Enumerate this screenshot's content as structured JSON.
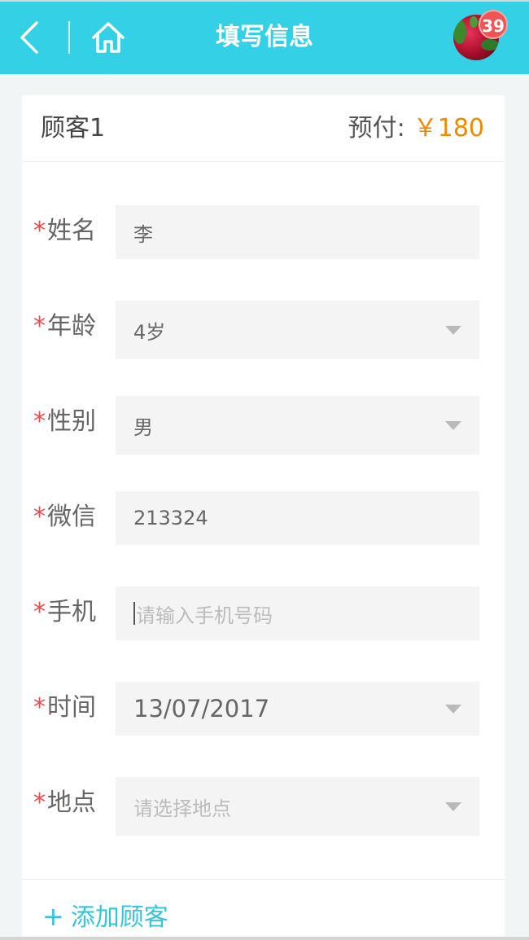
{
  "header": {
    "title": "填写信息",
    "badge_count": "39",
    "accent_color": "#33d0e6"
  },
  "customer": {
    "title": "顾客1",
    "prepay_label": "预付:",
    "prepay_amount": "￥180",
    "amount_color": "#f08a00"
  },
  "form": {
    "required_mark": "*",
    "name": {
      "label": "姓名",
      "value": "李"
    },
    "age": {
      "label": "年龄",
      "value": "4岁"
    },
    "gender": {
      "label": "性别",
      "value": "男"
    },
    "wechat": {
      "label": "微信",
      "value": "213324"
    },
    "phone": {
      "label": "手机",
      "placeholder": "请输入手机号码"
    },
    "time": {
      "label": "时间",
      "value": "13/07/2017"
    },
    "place": {
      "label": "地点",
      "placeholder": "请选择地点"
    }
  },
  "footer": {
    "add_plus": "+",
    "add_label": "添加顾客"
  },
  "icons": {
    "back": "back-icon",
    "home": "home-icon",
    "dropdown": "chevron-down-icon"
  }
}
